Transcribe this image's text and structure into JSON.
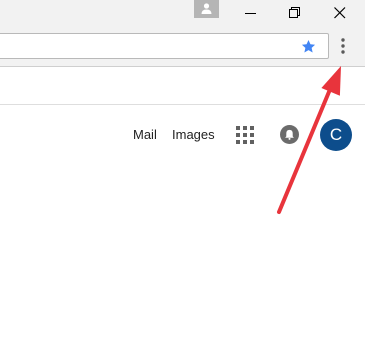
{
  "header": {
    "links": [
      "Mail",
      "Images"
    ],
    "avatar_letter": "C"
  },
  "icons": {
    "profile": "person-icon",
    "minimize": "minimize-icon",
    "restore": "restore-icon",
    "close": "close-icon",
    "bookmark": "star-icon",
    "menu": "vertical-dots-icon",
    "apps": "grid-apps-icon",
    "notifications": "bell-icon"
  },
  "colors": {
    "accent_blue": "#4285f4",
    "avatar": "#0d4d8c",
    "annotation_arrow": "#e8343c"
  }
}
